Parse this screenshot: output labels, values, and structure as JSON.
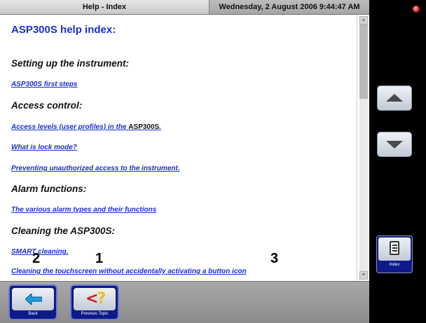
{
  "titlebar": {
    "title": "Help - Index",
    "datetime": "Wednesday, 2 August 2006 9:44:47 AM"
  },
  "content": {
    "heading": "ASP300S help index:",
    "sections": [
      {
        "title": "Setting up the instrument:",
        "links": [
          "ASP300S first steps"
        ]
      },
      {
        "title": "Access control:",
        "links": [
          "Access levels (user profiles) in the ",
          "What is lock mode?",
          "Preventing unauthorized access to the instrument."
        ]
      },
      {
        "title": "Alarm functions:",
        "links": [
          "The various alarm types and their functions"
        ]
      },
      {
        "title": "Cleaning the ASP300S:",
        "links": [
          "SMART cleaning.",
          "Cleaning the touchscreen without accidentally activating a button icon"
        ]
      }
    ],
    "access_link_strong": "ASP300S"
  },
  "sidebar": {
    "index_label": "Index"
  },
  "bottombar": {
    "back_label": "Back",
    "previous_topic_label": "Previous Topic"
  },
  "callouts": [
    "2",
    "1",
    "3"
  ],
  "colors": {
    "accent_blue": "#1a2fd0",
    "button_navy": "#0e1a8a"
  }
}
